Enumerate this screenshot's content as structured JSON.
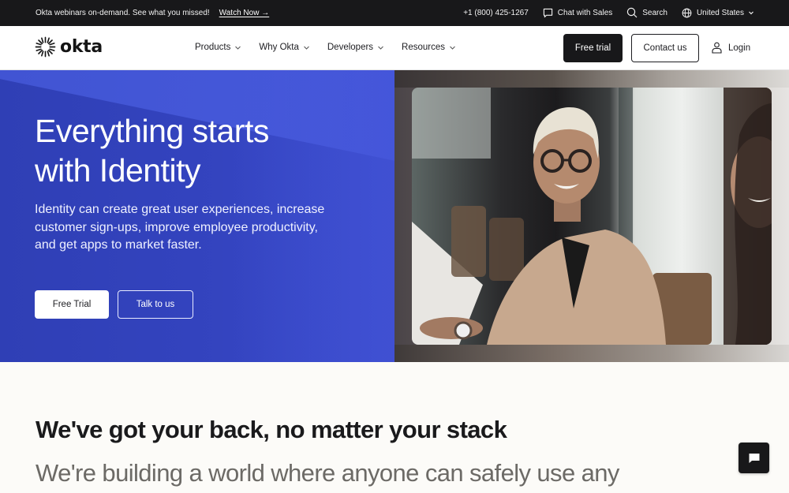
{
  "topbar": {
    "promo_text": "Okta webinars on-demand. See what you missed!",
    "promo_link": "Watch Now →",
    "phone": "+1 (800) 425-1267",
    "chat_label": "Chat with Sales",
    "search_label": "Search",
    "region_label": "United States",
    "icons": {
      "chat": "chat-bubble-icon",
      "search": "search-icon",
      "region": "globe-icon",
      "region_caret": "chevron-down-icon"
    }
  },
  "nav": {
    "logo_text": "okta",
    "menu": [
      {
        "label": "Products"
      },
      {
        "label": "Why Okta"
      },
      {
        "label": "Developers"
      },
      {
        "label": "Resources"
      }
    ],
    "free_trial": "Free trial",
    "contact": "Contact us",
    "login": "Login"
  },
  "hero": {
    "title_line1": "Everything starts",
    "title_line2": "with Identity",
    "subtitle": "Identity can create great user experiences, increase customer sign-ups, improve employee productivity, and get apps to market faster.",
    "primary_cta": "Free Trial",
    "secondary_cta": "Talk to us",
    "image_alt": "Smiling woman with short platinum hair and glasses in a tan blazer at a meeting table"
  },
  "section": {
    "title": "We've got your back, no matter your stack",
    "subtitle": "We're building a world where anyone can safely use any"
  },
  "chat_widget": {
    "icon": "chat-bubble-icon"
  },
  "colors": {
    "topbar_bg": "#18181a",
    "hero_blue": "#3444c0",
    "primary_button": "#18181a",
    "page_bg": "#fcfbf8"
  }
}
